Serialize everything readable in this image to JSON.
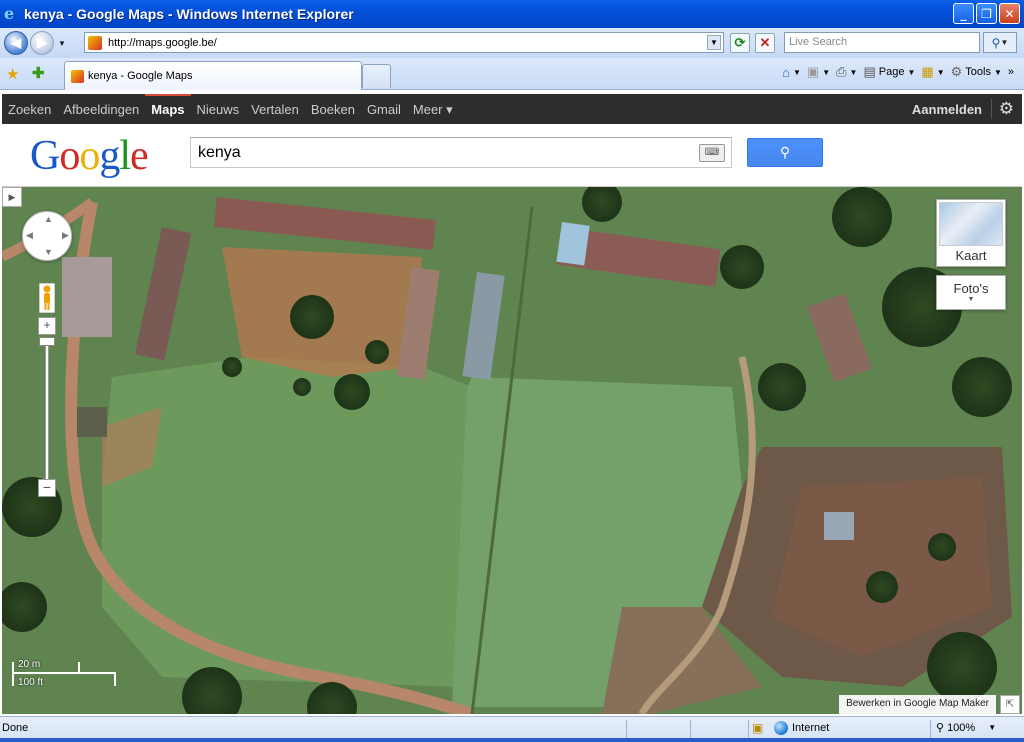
{
  "window": {
    "title": "kenya - Google Maps - Windows Internet Explorer",
    "ie_logo": "e",
    "minimize": "_",
    "restore": "❐",
    "close": "✕"
  },
  "addressbar": {
    "url": "http://maps.google.be/",
    "live_search_placeholder": "Live Search"
  },
  "tabs": [
    {
      "title": "kenya - Google Maps"
    }
  ],
  "command_bar": {
    "page_label": "Page",
    "tools_label": "Tools",
    "more": "»"
  },
  "google_bar": {
    "items": [
      "Zoeken",
      "Afbeeldingen",
      "Maps",
      "Nieuws",
      "Vertalen",
      "Boeken",
      "Gmail",
      "Meer ▾"
    ],
    "active_index": 2,
    "sign_in": "Aanmelden",
    "active_color": "#dd4b39"
  },
  "search": {
    "logo_letters": [
      "G",
      "o",
      "o",
      "g",
      "l",
      "e"
    ],
    "query": "kenya"
  },
  "map": {
    "zoom_in": "+",
    "zoom_out": "−",
    "map_type_label": "Kaart",
    "photos_label": "Foto's",
    "scale_metric": "20 m",
    "scale_imperial": "100 ft",
    "map_maker_link": "Bewerken in Google Map Maker"
  },
  "statusbar": {
    "status": "Done",
    "zone": "Internet",
    "zoom": "100%"
  }
}
